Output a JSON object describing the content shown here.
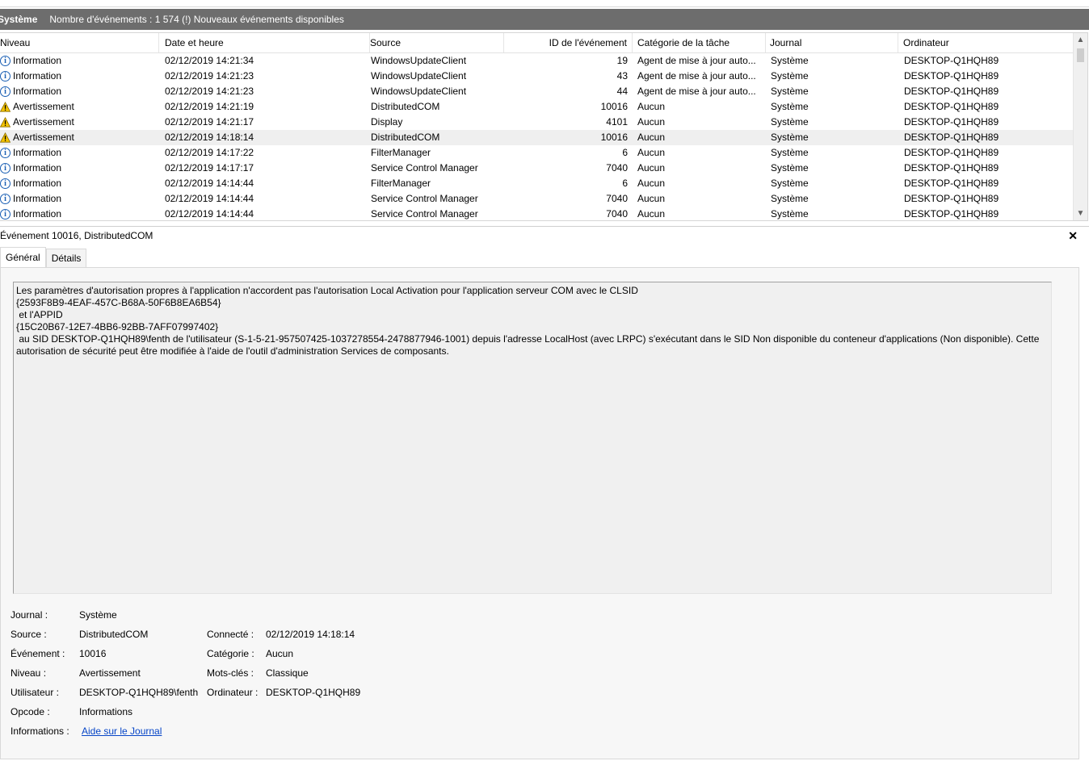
{
  "header": {
    "log_name": "Système",
    "summary": "Nombre d'événements : 1 574 (!) Nouveaux événements disponibles"
  },
  "columns": [
    "Niveau",
    "Date et heure",
    "Source",
    "ID de l'événement",
    "Catégorie de la tâche",
    "Journal",
    "Ordinateur"
  ],
  "events": [
    {
      "level": "Information",
      "icon": "info-icon",
      "date": "02/12/2019 14:21:34",
      "source": "WindowsUpdateClient",
      "id": "19",
      "category": "Agent de mise à jour auto...",
      "log": "Système",
      "computer": "DESKTOP-Q1HQH89"
    },
    {
      "level": "Information",
      "icon": "info-icon",
      "date": "02/12/2019 14:21:23",
      "source": "WindowsUpdateClient",
      "id": "43",
      "category": "Agent de mise à jour auto...",
      "log": "Système",
      "computer": "DESKTOP-Q1HQH89"
    },
    {
      "level": "Information",
      "icon": "info-icon",
      "date": "02/12/2019 14:21:23",
      "source": "WindowsUpdateClient",
      "id": "44",
      "category": "Agent de mise à jour auto...",
      "log": "Système",
      "computer": "DESKTOP-Q1HQH89"
    },
    {
      "level": "Avertissement",
      "icon": "warning-icon",
      "date": "02/12/2019 14:21:19",
      "source": "DistributedCOM",
      "id": "10016",
      "category": "Aucun",
      "log": "Système",
      "computer": "DESKTOP-Q1HQH89"
    },
    {
      "level": "Avertissement",
      "icon": "warning-icon",
      "date": "02/12/2019 14:21:17",
      "source": "Display",
      "id": "4101",
      "category": "Aucun",
      "log": "Système",
      "computer": "DESKTOP-Q1HQH89"
    },
    {
      "level": "Avertissement",
      "icon": "warning-icon",
      "date": "02/12/2019 14:18:14",
      "source": "DistributedCOM",
      "id": "10016",
      "category": "Aucun",
      "log": "Système",
      "computer": "DESKTOP-Q1HQH89",
      "selected": true
    },
    {
      "level": "Information",
      "icon": "info-icon",
      "date": "02/12/2019 14:17:22",
      "source": "FilterManager",
      "id": "6",
      "category": "Aucun",
      "log": "Système",
      "computer": "DESKTOP-Q1HQH89"
    },
    {
      "level": "Information",
      "icon": "info-icon",
      "date": "02/12/2019 14:17:17",
      "source": "Service Control Manager",
      "id": "7040",
      "category": "Aucun",
      "log": "Système",
      "computer": "DESKTOP-Q1HQH89"
    },
    {
      "level": "Information",
      "icon": "info-icon",
      "date": "02/12/2019 14:14:44",
      "source": "FilterManager",
      "id": "6",
      "category": "Aucun",
      "log": "Système",
      "computer": "DESKTOP-Q1HQH89"
    },
    {
      "level": "Information",
      "icon": "info-icon",
      "date": "02/12/2019 14:14:44",
      "source": "Service Control Manager",
      "id": "7040",
      "category": "Aucun",
      "log": "Système",
      "computer": "DESKTOP-Q1HQH89"
    },
    {
      "level": "Information",
      "icon": "info-icon",
      "date": "02/12/2019 14:14:44",
      "source": "Service Control Manager",
      "id": "7040",
      "category": "Aucun",
      "log": "Système",
      "computer": "DESKTOP-Q1HQH89"
    }
  ],
  "detail": {
    "title": "Événement 10016, DistributedCOM",
    "tabs": [
      "Général",
      "Détails"
    ],
    "description": "Les paramètres d'autorisation propres à l'application n'accordent pas l'autorisation Local Activation pour l'application serveur COM avec le CLSID\n{2593F8B9-4EAF-457C-B68A-50F6B8EA6B54}\n et l'APPID\n{15C20B67-12E7-4BB6-92BB-7AFF07997402}\n au SID DESKTOP-Q1HQH89\\fenth de l'utilisateur (S-1-5-21-957507425-1037278554-2478877946-1001) depuis l'adresse LocalHost (avec LRPC) s'exécutant dans le SID Non disponible du conteneur d'applications (Non disponible). Cette\nautorisation de sécurité peut être modifiée à l'aide de l'outil d'administration Services de composants.",
    "labels": {
      "journal": "Journal :",
      "source": "Source :",
      "event": "Événement :",
      "level": "Niveau :",
      "user": "Utilisateur :",
      "opcode": "Opcode :",
      "info": "Informations :",
      "logged": "Connecté :",
      "category": "Catégorie :",
      "keywords": "Mots-clés :",
      "computer": "Ordinateur :"
    },
    "values": {
      "journal": "Système",
      "source": "DistributedCOM",
      "event": "10016",
      "level": "Avertissement",
      "user": "DESKTOP-Q1HQH89\\fenth",
      "opcode": "Informations",
      "info_link": "Aide sur le Journal",
      "logged": "02/12/2019 14:18:14",
      "category": "Aucun",
      "keywords": "Classique",
      "computer": "DESKTOP-Q1HQH89"
    }
  },
  "colors": {
    "title_bar": "#6d6d6d",
    "selected_row": "#efefef",
    "link": "#0645c7",
    "info_icon": "#1a5fb4",
    "warning_icon": "#f5c400"
  }
}
